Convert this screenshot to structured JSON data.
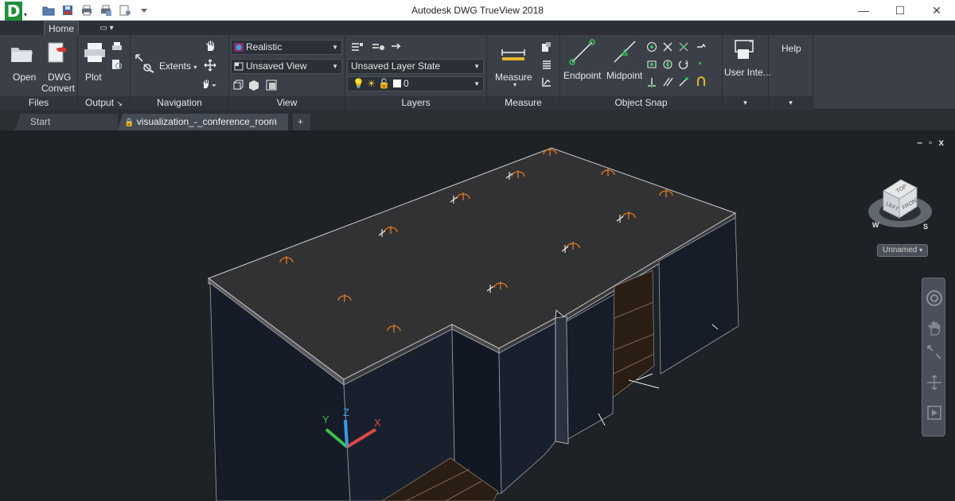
{
  "window": {
    "title": "Autodesk DWG TrueView 2018",
    "app_logo_letter": "D",
    "controls": {
      "minimize": "—",
      "maximize": "☐",
      "close": "✕"
    }
  },
  "ribbon_tabs": [
    {
      "label": "Home",
      "active": true
    },
    {
      "label": "▭ ▾",
      "active": false
    }
  ],
  "ribbon": {
    "files": {
      "label": "Files",
      "open": "Open",
      "dwg_convert_line1": "DWG",
      "dwg_convert_line2": "Convert"
    },
    "output": {
      "label": "Output",
      "plot": "Plot",
      "dialog_launcher": "↘"
    },
    "navigation": {
      "label": "Navigation",
      "extents": "Extents"
    },
    "view": {
      "label": "View",
      "visual_style": "Realistic",
      "named_view": "Unsaved View"
    },
    "layers": {
      "label": "Layers",
      "layer_state": "Unsaved Layer State",
      "current_layer": "0"
    },
    "measure": {
      "label": "Measure",
      "measure": "Measure"
    },
    "object_snap": {
      "label": "Object Snap",
      "endpoint": "Endpoint",
      "midpoint": "Midpoint"
    },
    "user_interface": {
      "label": "User Inte..."
    },
    "help": {
      "label": "Help"
    }
  },
  "doc_tabs": {
    "start": "Start",
    "active": "visualization_-_conference_room",
    "close": "✕",
    "new": "+"
  },
  "viewport": {
    "controls": {
      "minimize": "–",
      "restore": "▫",
      "close": "x"
    },
    "viewcube": {
      "top": "TOP",
      "left": "LEFT",
      "front": "FRONT",
      "compass_w": "W",
      "compass_s": "S"
    },
    "ucs_menu": "Unnamed"
  },
  "colors": {
    "accent_green": "#1f8f3a",
    "ribbon_bg": "#3b4048",
    "viewport_bg": "#1e2126",
    "light_fixture": "#e07a1f",
    "snap_marker": "#34c759"
  },
  "icons": [
    "open-folder-icon",
    "dwg-convert-icon",
    "plot-printer-icon",
    "pan-hand-icon",
    "zoom-extents-icon",
    "orbit-icon",
    "measure-ruler-icon",
    "endpoint-snap-icon",
    "midpoint-snap-icon",
    "user-interface-icon",
    "ucs-icon"
  ]
}
